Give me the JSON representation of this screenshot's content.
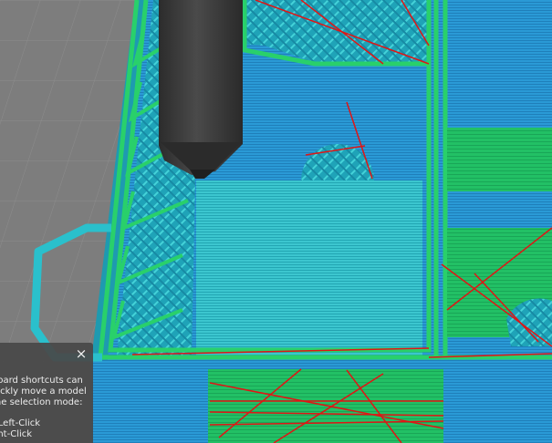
{
  "tooltip": {
    "close_label": "×",
    "lines": [
      "board shortcuts can",
      "uickly move a model",
      "the selection mode:"
    ],
    "shortcut_left": "- Left-Click",
    "shortcut_right": "ght-Click"
  },
  "colors": {
    "background": "#7d7d7d",
    "infill_cyan": "#27b9c4",
    "perimeter_green": "#29d06b",
    "solid_blue": "#2a9ad6",
    "travel_red": "#e01515",
    "nozzle": "#3a3a3a"
  },
  "icons": {
    "close": "close-icon"
  }
}
